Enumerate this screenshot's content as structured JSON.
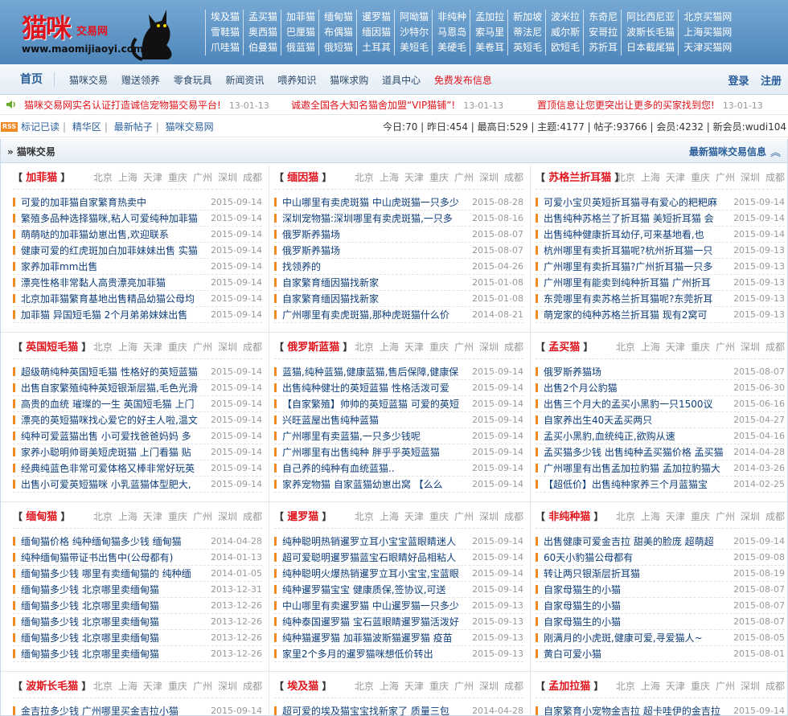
{
  "logo": {
    "brand": "猫咪",
    "sub": "交易网",
    "url": "www.maomijiaoyi.com"
  },
  "toplinks": [
    [
      "埃及猫",
      "孟买猫",
      "加菲猫",
      "缅甸猫",
      "暹罗猫",
      "阿呦猫",
      "非纯种",
      "孟加拉",
      "新加坡",
      "波米拉",
      "东奇尼",
      "阿比西尼亚",
      "北京买猫网"
    ],
    [
      "雪鞋猫",
      "奥西猫",
      "巴厘猫",
      "布偶猫",
      "缅因猫",
      "沙特尔",
      "马恩岛",
      "索马里",
      "蒂法尼",
      "威尔斯",
      "安哥拉",
      "波斯长毛猫",
      "上海买猫网"
    ],
    [
      "爪哇猫",
      "伯曼猫",
      "俄蓝猫",
      "俄短猫",
      "土耳其",
      "美短毛",
      "美硬毛",
      "美卷耳",
      "英短毛",
      "欧短毛",
      "苏折耳",
      "日本截尾猫",
      "天津买猫网"
    ]
  ],
  "nav": {
    "home": "首页",
    "links": [
      "猫咪交易",
      "赠送领养",
      "零食玩具",
      "新闻资讯",
      "喂养知识",
      "猫咪求购",
      "道具中心"
    ],
    "highlight": "免费发布信息",
    "login": "登录",
    "register": "注册"
  },
  "notices": [
    {
      "text": "猫咪交易网实名认证打造诚信宠物猫交易平台!",
      "date": "13-01-13"
    },
    {
      "text": "诚邀全国各大知名猫舍加盟“VIP猫铺”!",
      "date": "13-01-13"
    },
    {
      "text": "置顶信息让您更突出让更多的买家找到您!",
      "date": "13-01-13"
    }
  ],
  "stats": {
    "rss": "RSS",
    "links": [
      "标记已读",
      "精华区",
      "最新帖子",
      "猫咪交易网"
    ],
    "summary": "今日:70 | 昨日:454 | 最高日:529 | 主题:4177 | 帖子:93766 | 会员:4232 | 新会员:wudi104"
  },
  "section": {
    "title": "» 猫咪交易",
    "right": "最新猫咪交易信息",
    "collapse": "︽"
  },
  "cities": [
    "北京",
    "上海",
    "天津",
    "重庆",
    "广州",
    "深圳",
    "成都"
  ],
  "boxes": [
    {
      "cat": "加菲猫",
      "items": [
        [
          "可爱的加菲猫自家繁育热卖中",
          "2015-09-14"
        ],
        [
          "繁殖多品种选择猫咪,粘人可爱纯种加菲猫",
          "2015-09-14"
        ],
        [
          "萌萌哒的加菲猫幼崽出售,欢迎联系",
          "2015-09-14"
        ],
        [
          "健康可爱的红虎斑加白加菲妹妹出售 实猫",
          "2015-09-14"
        ],
        [
          "家养加菲mm出售",
          "2015-09-14"
        ],
        [
          "漂亮性格非常黏人高贵漂亮加菲猫",
          "2015-09-14"
        ],
        [
          "北京加菲猫繁育基地出售精品幼猫公母均",
          "2015-09-14"
        ],
        [
          "加菲猫 异国短毛猫 2个月弟弟妹妹出售",
          "2015-09-14"
        ]
      ]
    },
    {
      "cat": "缅因猫",
      "items": [
        [
          "中山哪里有卖虎斑猫 中山虎斑猫一只多少",
          "2015-08-28"
        ],
        [
          "深圳宠物猫:深圳哪里有卖虎斑猫,一只多",
          "2015-08-16"
        ],
        [
          "俄罗斯养猫场",
          "2015-08-07"
        ],
        [
          "俄罗斯养猫场",
          "2015-08-07"
        ],
        [
          "找领养的",
          "2015-04-26"
        ],
        [
          "自家繁育缅因猫找新家",
          "2015-01-08"
        ],
        [
          "自家繁育缅因猫找新家",
          "2015-01-08"
        ],
        [
          "广州哪里有卖虎斑猫,那种虎斑猫什么价",
          "2014-08-21"
        ]
      ]
    },
    {
      "cat": "苏格兰折耳猫",
      "items": [
        [
          "可爱小宝贝英短折耳猫寻有爱心的粑粑麻",
          "2015-09-14"
        ],
        [
          "出售纯种苏格兰了折耳猫 美短折耳猫 会",
          "2015-09-14"
        ],
        [
          "出售纯种健康折耳幼仔,可来基地看,也",
          "2015-09-14"
        ],
        [
          "杭州哪里有卖折耳猫呢?杭州折耳猫一只",
          "2015-09-13"
        ],
        [
          "广州哪里有卖折耳猫?广州折耳猫一只多",
          "2015-09-13"
        ],
        [
          "广州哪里有能卖到纯种折耳猫 广州折耳",
          "2015-09-13"
        ],
        [
          "东莞哪里有卖苏格兰折耳猫呢?东莞折耳",
          "2015-09-13"
        ],
        [
          "萌宠家的纯种苏格兰折耳猫 现有2窝可",
          "2015-09-13"
        ]
      ]
    },
    {
      "cat": "英国短毛猫",
      "items": [
        [
          "超级萌纯种英国短毛猫 性格好的英短蓝猫",
          "2015-09-14"
        ],
        [
          "出售自家繁殖纯种英短银渐层猫,毛色光滑",
          "2015-09-14"
        ],
        [
          "高贵的血统 璀璨的一生 英国短毛猫 上门",
          "2015-09-14"
        ],
        [
          "漂亮的英短猫咪找心爱它的好主人啦,温文",
          "2015-09-14"
        ],
        [
          "纯种可爱蓝猫出售 小可爱找爸爸妈妈 多",
          "2015-09-14"
        ],
        [
          "家养小聪明帅哥美短虎斑猫 上门看猫 贴",
          "2015-09-14"
        ],
        [
          "经典纯蓝色非常可爱体格又棒非常好玩英",
          "2015-09-14"
        ],
        [
          "出售小可爱英短猫咪 小乳蓝猫体型肥大,",
          "2015-09-14"
        ]
      ]
    },
    {
      "cat": "俄罗斯蓝猫",
      "items": [
        [
          "蓝猫,纯种蓝猫,健康蓝猫,售后保障,健康保",
          "2015-09-14"
        ],
        [
          "出售纯种健壮的英短蓝猫 性格活泼可爱",
          "2015-09-14"
        ],
        [
          "【自家繁殖】帅帅的英短蓝猫 可爱的英短",
          "2015-09-14"
        ],
        [
          "兴旺蓝屋出售纯种蓝猫",
          "2015-09-14"
        ],
        [
          "广州哪里有卖蓝猫,一只多少钱呢",
          "2015-09-14"
        ],
        [
          "广州哪里有出售纯种 胖乎乎英短蓝猫",
          "2015-09-14"
        ],
        [
          "自己养的纯种有血统蓝猫..",
          "2015-09-14"
        ],
        [
          "家养宠物猫 自家蓝猫幼崽出窝 【么么",
          "2015-09-14"
        ]
      ]
    },
    {
      "cat": "孟买猫",
      "items": [
        [
          "俄罗斯养猫场",
          "2015-08-07"
        ],
        [
          "出售2个月公豹猫",
          "2015-06-30"
        ],
        [
          "出售三个月大的孟买小黑豹一只1500议",
          "2015-06-16"
        ],
        [
          "自家养出生40天孟买两只",
          "2015-04-27"
        ],
        [
          "孟买小黑豹,血统纯正,欲购从速",
          "2015-04-16"
        ],
        [
          "孟买猫多少钱 出售纯种孟买猫价格 孟买猫图",
          "2014-04-28"
        ],
        [
          "广州哪里有出售孟加拉豹猫 孟加拉豹猫大",
          "2014-03-26"
        ],
        [
          "【超低价】出售纯种家养三个月蓝猫宝",
          "2014-02-25"
        ]
      ]
    },
    {
      "cat": "缅甸猫",
      "items": [
        [
          "缅甸猫价格 纯种缅甸猫多少钱 缅甸猫",
          "2014-04-28"
        ],
        [
          "纯种缅甸猫带证书出售中(公母都有)",
          "2014-01-13"
        ],
        [
          "缅甸猫多少钱 哪里有卖缅甸猫的 纯种缅",
          "2014-01-05"
        ],
        [
          "缅甸猫多少钱 北京哪里卖缅甸猫",
          "2013-12-31"
        ],
        [
          "缅甸猫多少钱 北京哪里卖缅甸猫",
          "2013-12-26"
        ],
        [
          "缅甸猫多少钱 北京哪里卖缅甸猫",
          "2013-12-26"
        ],
        [
          "缅甸猫多少钱 北京哪里卖缅甸猫",
          "2013-12-26"
        ],
        [
          "缅甸猫多少钱 北京哪里卖缅甸猫",
          "2013-12-26"
        ]
      ]
    },
    {
      "cat": "暹罗猫",
      "items": [
        [
          "纯种聪明热销暹罗立耳小宝宝蓝眼睛迷人",
          "2015-09-14"
        ],
        [
          "超可爱聪明暹罗猫蓝宝石眼睛好品相粘人",
          "2015-09-14"
        ],
        [
          "纯种聪明火爆热销暹罗立耳小宝宝,宝蓝眼",
          "2015-09-14"
        ],
        [
          "纯种暹罗猫宝宝 健康质保,签协议,可送",
          "2015-09-14"
        ],
        [
          "中山哪里有卖暹罗猫 中山暹罗猫一只多少",
          "2015-09-13"
        ],
        [
          "纯种泰国暹罗猫 宝石蓝眼睛暹罗猫活泼好",
          "2015-09-13"
        ],
        [
          "纯种猫暹罗猫 加菲猫波斯猫暹罗猫 疫苗",
          "2015-09-13"
        ],
        [
          "家里2个多月的暹罗猫咪想低价转出",
          "2015-09-13"
        ]
      ]
    },
    {
      "cat": "非纯种猫",
      "items": [
        [
          "出售健康可爱金吉拉 甜美的脸庞 超萌超",
          "2015-09-14"
        ],
        [
          "60天小豹猫公母都有",
          "2015-09-08"
        ],
        [
          "转让两只银渐层折耳猫",
          "2015-08-19"
        ],
        [
          "自家母猫生的小猫",
          "2015-08-07"
        ],
        [
          "自家母猫生的小猫",
          "2015-08-07"
        ],
        [
          "自家母猫生的小猫",
          "2015-08-07"
        ],
        [
          "刚满月的小虎斑,健康可爱,寻爱猫人~",
          "2015-08-05"
        ],
        [
          "黄白可爱小猫",
          "2015-08-01"
        ]
      ]
    },
    {
      "cat": "波斯长毛猫",
      "items": [
        [
          "金吉拉多少钱 广州哪里买金吉拉小猫",
          "2015-09-14"
        ]
      ]
    },
    {
      "cat": "埃及猫",
      "items": [
        [
          "超可爱的埃及猫宝宝找新家了 质量三包",
          "2014-04-28"
        ]
      ]
    },
    {
      "cat": "孟加拉猫",
      "items": [
        [
          "自家繁育小宠物金吉拉 超卡哇伊的金吉拉",
          "2015-09-14"
        ]
      ]
    }
  ]
}
